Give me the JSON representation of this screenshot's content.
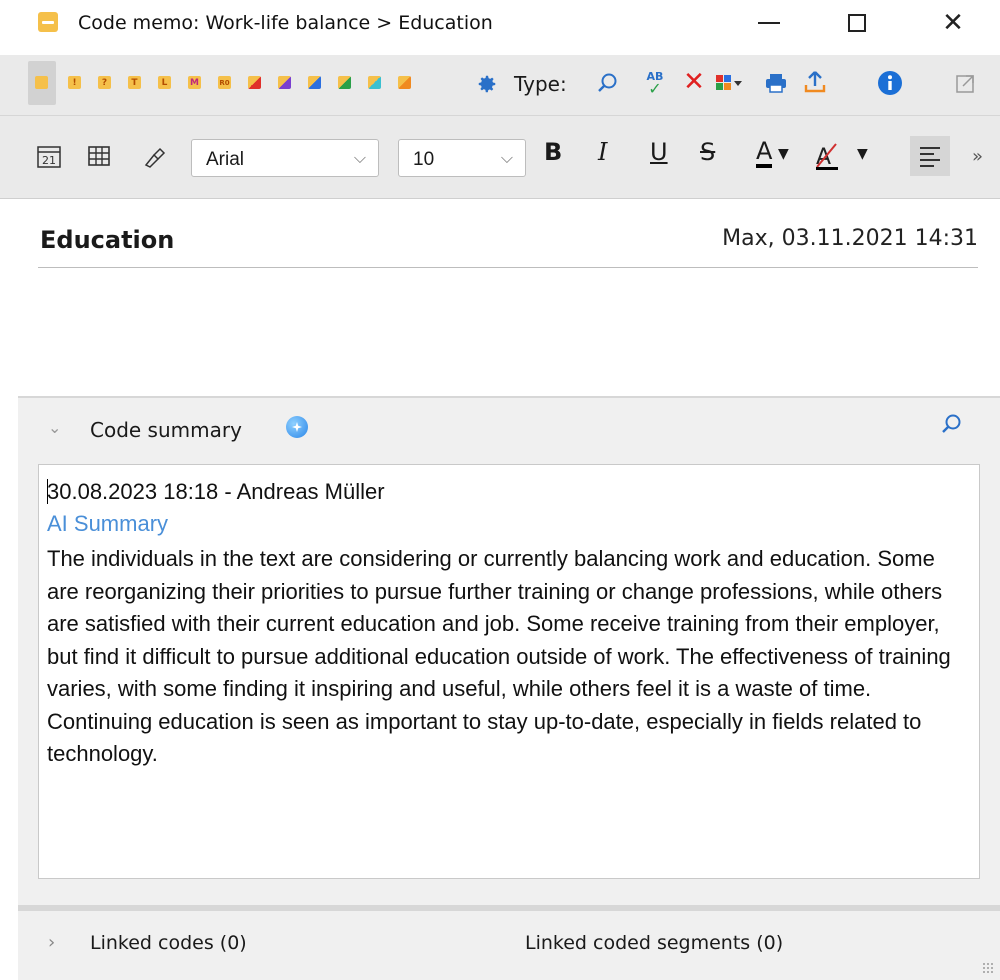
{
  "window": {
    "title": "Code memo: Work-life balance > Education"
  },
  "toolbar": {
    "code_chips": [
      "!",
      "?",
      "T",
      "L",
      "M",
      "R0"
    ],
    "type_label": "Type:",
    "spellcheck_label": "AB"
  },
  "format_bar": {
    "font_family": "Arial",
    "font_size": "10",
    "bold": "B",
    "italic": "I",
    "underline": "U",
    "strike": "S",
    "font_color": "A",
    "more": "»"
  },
  "memo": {
    "title": "Education",
    "meta": "Max, 03.11.2021 14:31"
  },
  "summary": {
    "header": "Code summary",
    "line1": "30.08.2023 18:18 - Andreas Müller",
    "ai_label": "AI Summary",
    "body": "The individuals in the text are considering or currently balancing work and education. Some are reorganizing their priorities to pursue further training or change professions, while others are satisfied with their current education and job. Some receive training from their employer, but find it difficult to pursue additional education outside of work. The effectiveness of training varies, with some finding it inspiring and useful, while others feel it is a waste of time. Continuing education is seen as important to stay up-to-date, especially in fields related to technology."
  },
  "footer": {
    "linked_codes": "Linked codes (0)",
    "linked_segments": "Linked coded segments (0)"
  },
  "colors": {
    "accent": "#2a86e8",
    "ai_label": "#4a8fd8",
    "memo_icon": "#f5c04a",
    "delete_red": "#e02020"
  }
}
